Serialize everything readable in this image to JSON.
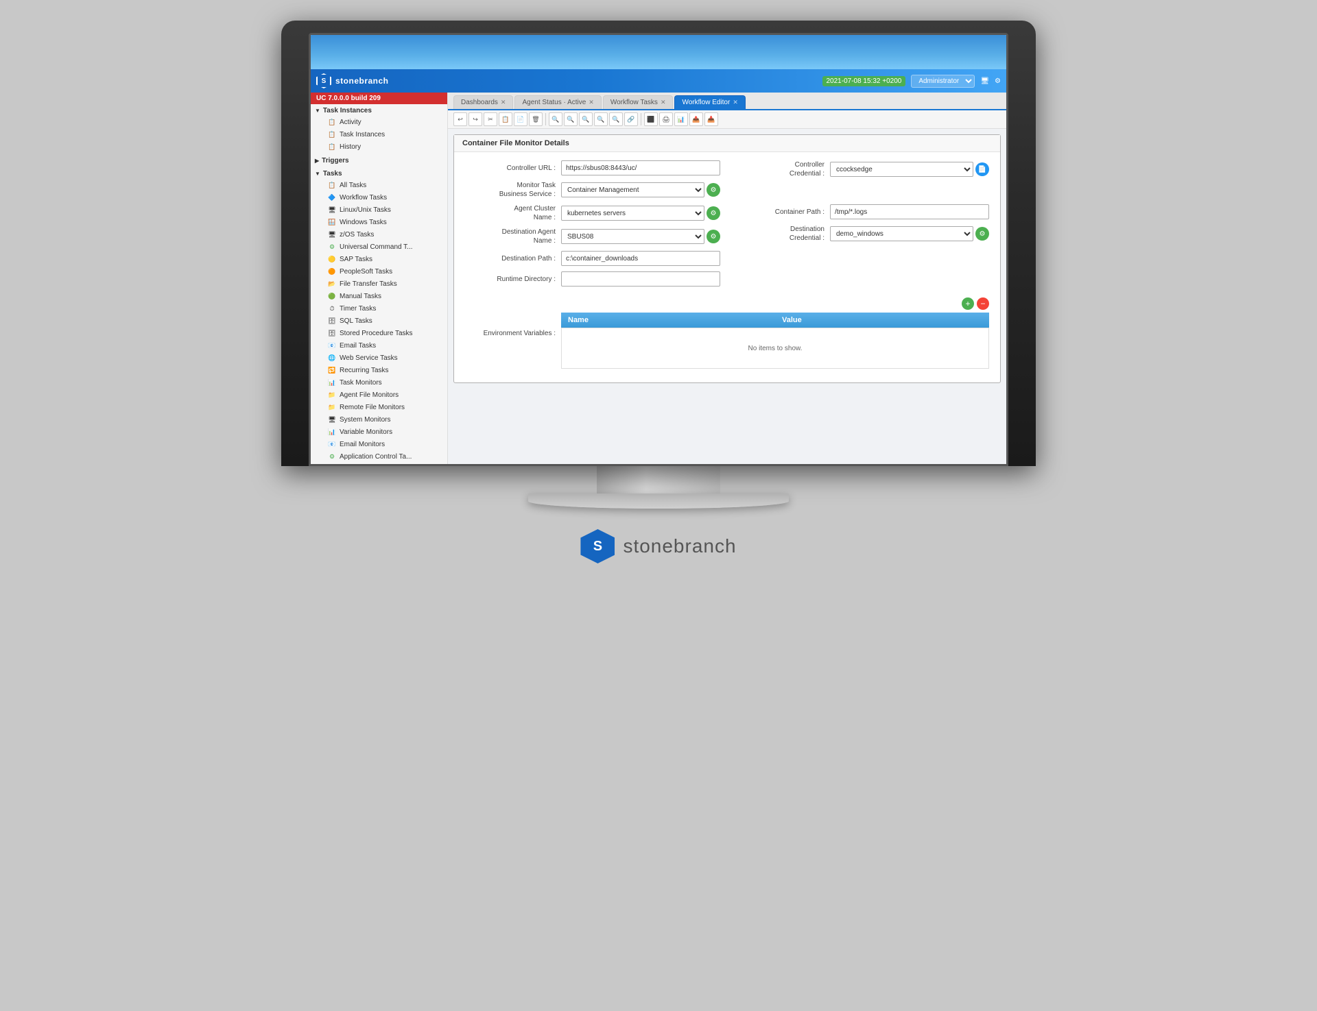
{
  "app": {
    "logo_letter": "S",
    "logo_name": "stonebranch",
    "version_badge": "UC 7.0.0.0 build 209",
    "datetime": "2021-07-08 15:32 +0200",
    "user": "Administrator"
  },
  "tabs": [
    {
      "label": "Dashboards",
      "active": false
    },
    {
      "label": "Agent Status · Active",
      "active": false
    },
    {
      "label": "Workflow Tasks",
      "active": false
    },
    {
      "label": "Workflow Editor",
      "active": true
    }
  ],
  "sidebar": {
    "groups": [
      {
        "label": "Task Instances",
        "expanded": true,
        "items": [
          {
            "label": "Activity",
            "icon": "📋"
          },
          {
            "label": "Task Instances",
            "icon": "📋"
          },
          {
            "label": "History",
            "icon": "📋"
          }
        ]
      },
      {
        "label": "Triggers",
        "expanded": false,
        "items": []
      },
      {
        "label": "Tasks",
        "expanded": true,
        "items": [
          {
            "label": "All Tasks",
            "icon": "📋"
          },
          {
            "label": "Workflow Tasks",
            "icon": "🔷"
          },
          {
            "label": "Linux/Unix Tasks",
            "icon": "🖥"
          },
          {
            "label": "Windows Tasks",
            "icon": "🪟"
          },
          {
            "label": "z/OS Tasks",
            "icon": "🖥"
          },
          {
            "label": "Universal Command T...",
            "icon": "⚙"
          },
          {
            "label": "SAP Tasks",
            "icon": "🟡"
          },
          {
            "label": "PeopleSoft Tasks",
            "icon": "🟠"
          },
          {
            "label": "File Transfer Tasks",
            "icon": "📂"
          },
          {
            "label": "Manual Tasks",
            "icon": "🟢"
          },
          {
            "label": "Timer Tasks",
            "icon": "⏱"
          },
          {
            "label": "SQL Tasks",
            "icon": "🗄"
          },
          {
            "label": "Stored Procedure Tasks",
            "icon": "🗄"
          },
          {
            "label": "Email Tasks",
            "icon": "📧"
          },
          {
            "label": "Web Service Tasks",
            "icon": "🌐"
          },
          {
            "label": "Recurring Tasks",
            "icon": "🔁"
          },
          {
            "label": "Task Monitors",
            "icon": "📊"
          },
          {
            "label": "Agent File Monitors",
            "icon": "📁"
          },
          {
            "label": "Remote File Monitors",
            "icon": "📁"
          },
          {
            "label": "System Monitors",
            "icon": "🖥"
          },
          {
            "label": "Variable Monitors",
            "icon": "📊"
          },
          {
            "label": "Email Monitors",
            "icon": "📧"
          },
          {
            "label": "Application Control Ta...",
            "icon": "⚙"
          }
        ]
      }
    ]
  },
  "toolbar_buttons": [
    "↩",
    "↪",
    "✂",
    "📋",
    "🖹",
    "🗑",
    "🔍",
    "🔍",
    "🔍",
    "🔗",
    "📌",
    "🖨",
    "📊",
    "📤",
    "📥"
  ],
  "form": {
    "panel_title": "Container File Monitor Details",
    "controller_url_label": "Controller URL :",
    "controller_url_value": "https://sbus08:8443/uc/",
    "controller_credential_label": "Controller Credential :",
    "controller_credential_value": "ccocksedge",
    "monitor_task_label": "Monitor Task Business Service :",
    "monitor_task_value": "Container Management",
    "agent_cluster_label": "Agent Cluster Name :",
    "agent_cluster_value": "kubernetes servers",
    "container_path_label": "Container Path :",
    "container_path_value": "/tmp/*.logs",
    "destination_agent_label": "Destination Agent Name :",
    "destination_agent_value": "SBUS08",
    "destination_credential_label": "Destination Credential :",
    "destination_credential_value": "demo_windows",
    "destination_path_label": "Destination Path :",
    "destination_path_value": "c:\\container_downloads",
    "runtime_directory_label": "Runtime Directory :",
    "runtime_directory_value": "",
    "env_variables_label": "Environment Variables :",
    "env_table": {
      "headers": [
        "Name",
        "Value"
      ],
      "empty_message": "No items to show."
    },
    "add_btn": "+",
    "del_btn": "−"
  },
  "bottom_logo": {
    "letter": "S",
    "name": "stonebranch"
  }
}
